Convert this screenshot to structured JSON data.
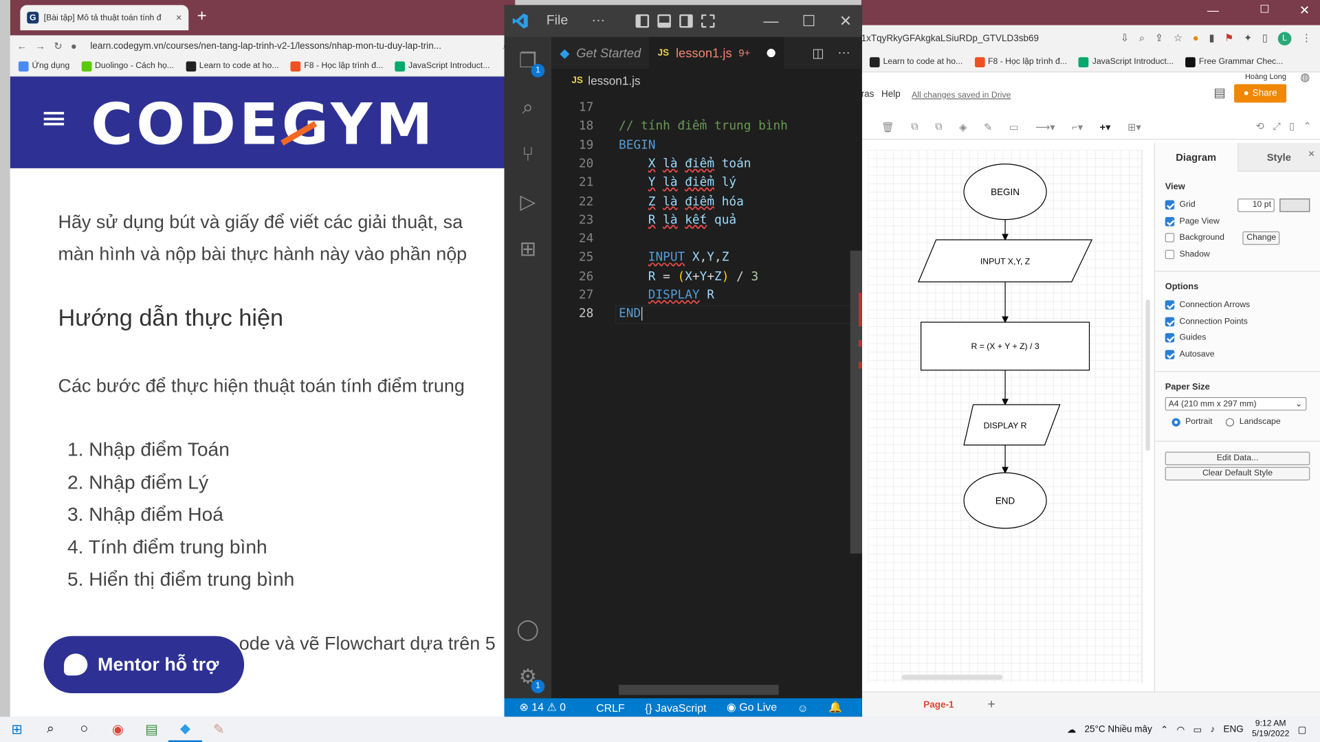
{
  "chrome_left": {
    "tab_title": "[Bài tập] Mô tả thuật toán tính đ",
    "tab_close": "×",
    "new_tab": "+",
    "url": "learn.codegym.vn/courses/nen-tang-lap-trinh-v2-1/lessons/nhap-mon-tu-duy-lap-trin...",
    "bookmarks": [
      "Ứng dụng",
      "Duolingo - Cách họ...",
      "Learn to code at ho...",
      "F8 - Học lập trình đ...",
      "JavaScript Introduct..."
    ],
    "site_logo": "CODEGYM",
    "paragraph_1": "Hãy sử dụng bút và giấy để viết các giải thuật, sa",
    "paragraph_2": "màn hình và nộp bài thực hành này vào phần nộp",
    "heading": "Hướng dẫn thực hiện",
    "steps_intro": "Các bước để thực hiện thuật toán tính điểm trung",
    "steps": [
      "Nhập điểm Toán",
      "Nhập điểm Lý",
      "Nhập điểm Hoá",
      "Tính điểm trung bình",
      "Hiển thị điểm trung bình"
    ],
    "last_line": "ode và vẽ Flowchart dựa trên 5",
    "mentor_button": "Mentor hỗ trợ"
  },
  "vscode": {
    "menu_file": "File",
    "menu_more": "···",
    "tabs": [
      {
        "label": "Get Started",
        "active": false
      },
      {
        "label": "lesson1.js",
        "badge": "9+",
        "active": true
      }
    ],
    "breadcrumb": "lesson1.js",
    "js_badge": "JS",
    "explorer_badge": "1",
    "settings_badge": "1",
    "lines": [
      {
        "num": "17",
        "tokens": []
      },
      {
        "num": "18",
        "tokens": [
          {
            "t": "// tính điểm trung bình",
            "c": "c"
          }
        ]
      },
      {
        "num": "19",
        "tokens": [
          {
            "t": "BEGIN",
            "c": "k"
          }
        ]
      },
      {
        "num": "20",
        "tokens": [
          {
            "t": "    "
          },
          {
            "t": "X",
            "c": "v sq"
          },
          {
            "t": " "
          },
          {
            "t": "là",
            "c": "v sq"
          },
          {
            "t": " "
          },
          {
            "t": "điểm",
            "c": "v sq"
          },
          {
            "t": " "
          },
          {
            "t": "toán",
            "c": "v"
          }
        ]
      },
      {
        "num": "21",
        "tokens": [
          {
            "t": "    "
          },
          {
            "t": "Y",
            "c": "v sq"
          },
          {
            "t": " "
          },
          {
            "t": "là",
            "c": "v sq"
          },
          {
            "t": " "
          },
          {
            "t": "điểm",
            "c": "v sq"
          },
          {
            "t": " "
          },
          {
            "t": "lý",
            "c": "v"
          }
        ]
      },
      {
        "num": "22",
        "tokens": [
          {
            "t": "    "
          },
          {
            "t": "Z",
            "c": "v sq"
          },
          {
            "t": " "
          },
          {
            "t": "là",
            "c": "v sq"
          },
          {
            "t": " "
          },
          {
            "t": "điểm",
            "c": "v sq"
          },
          {
            "t": " "
          },
          {
            "t": "hóa",
            "c": "v"
          }
        ]
      },
      {
        "num": "23",
        "tokens": [
          {
            "t": "    "
          },
          {
            "t": "R",
            "c": "v sq"
          },
          {
            "t": " "
          },
          {
            "t": "là",
            "c": "v sq"
          },
          {
            "t": " "
          },
          {
            "t": "kết",
            "c": "v sq"
          },
          {
            "t": " "
          },
          {
            "t": "quả",
            "c": "v"
          }
        ]
      },
      {
        "num": "24",
        "tokens": []
      },
      {
        "num": "25",
        "tokens": [
          {
            "t": "    "
          },
          {
            "t": "INPUT",
            "c": "k sq"
          },
          {
            "t": " "
          },
          {
            "t": "X",
            "c": "v"
          },
          {
            "t": ","
          },
          {
            "t": "Y",
            "c": "v"
          },
          {
            "t": ","
          },
          {
            "t": "Z",
            "c": "v"
          }
        ]
      },
      {
        "num": "26",
        "tokens": [
          {
            "t": "    "
          },
          {
            "t": "R",
            "c": "v"
          },
          {
            "t": " = "
          },
          {
            "t": "(",
            "c": "y"
          },
          {
            "t": "X",
            "c": "v"
          },
          {
            "t": "+"
          },
          {
            "t": "Y",
            "c": "v"
          },
          {
            "t": "+"
          },
          {
            "t": "Z",
            "c": "v"
          },
          {
            "t": ")",
            "c": "y"
          },
          {
            "t": " / "
          },
          {
            "t": "3",
            "c": "n"
          }
        ]
      },
      {
        "num": "27",
        "tokens": [
          {
            "t": "    "
          },
          {
            "t": "DISPLAY",
            "c": "k sq"
          },
          {
            "t": " "
          },
          {
            "t": "R",
            "c": "v"
          }
        ]
      },
      {
        "num": "28",
        "tokens": [
          {
            "t": "END",
            "c": "k"
          }
        ],
        "current": true
      }
    ],
    "status": {
      "errors": "14",
      "warnings": "0",
      "eol": "CRLF",
      "language": "JavaScript",
      "golive": "Go Live"
    }
  },
  "drawio": {
    "url": "1xTqyRkyGFAkgkaLSiuRDp_GTVLD3sb69",
    "bookmarks": [
      "Learn to code at ho...",
      "F8 - Học lập trình đ...",
      "JavaScript Introduct...",
      "Free Grammar Chec..."
    ],
    "menu_fragment": "ras",
    "menu_help": "Help",
    "saved_status": "All changes saved in Drive",
    "user_name": "Hoàng Long",
    "user_initial": "L",
    "share_label": "Share",
    "flowchart": {
      "begin": "BEGIN",
      "input": "INPUT X,Y, Z",
      "process": "R = (X + Y + Z) / 3",
      "display": "DISPLAY R",
      "end": "END"
    },
    "panel": {
      "tab_diagram": "Diagram",
      "tab_style": "Style",
      "close": "✕",
      "view_heading": "View",
      "grid": "Grid",
      "grid_size": "10 pt",
      "page_view": "Page View",
      "background": "Background",
      "change_button": "Change",
      "shadow": "Shadow",
      "options_heading": "Options",
      "connection_arrows": "Connection Arrows",
      "connection_points": "Connection Points",
      "guides": "Guides",
      "autosave": "Autosave",
      "paper_size_heading": "Paper Size",
      "paper_size_value": "A4 (210 mm x 297 mm)",
      "portrait": "Portrait",
      "landscape": "Landscape",
      "edit_data": "Edit Data...",
      "clear_default_style": "Clear Default Style"
    },
    "page_tab": "Page-1",
    "add_page": "+"
  },
  "taskbar": {
    "weather": "25°C  Nhiều mây",
    "lang": "ENG",
    "time": "9:12 AM",
    "date": "5/19/2022"
  }
}
